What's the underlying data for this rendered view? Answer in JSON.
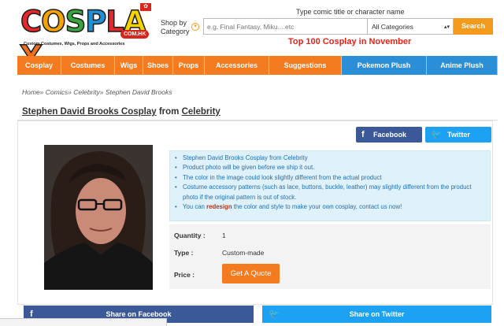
{
  "brand": {
    "logo_letters": [
      "C",
      "O",
      "S",
      "P",
      "L",
      "A",
      "Y"
    ],
    "logo_colors": [
      "#e5262b",
      "#f5a300",
      "#3aa53f",
      "#1f8fd6",
      "#e5262b",
      "#f5d100",
      "#ed6f1e"
    ],
    "logo_badge": "COM.HK",
    "logo_tagline": "Custom Costumes, Wigs, Props and Accessories"
  },
  "header": {
    "shop_by_line1": "Shop by",
    "shop_by_line2": "Category",
    "search_hint": "Type comic title or character name",
    "search_placeholder": "e.g. Final Fantasy, Miku....etc",
    "category_selected": "All Categories",
    "search_button": "Search",
    "promo_link": "Top 100 Cosplay in November"
  },
  "nav": {
    "items": [
      {
        "label": "Cosplay",
        "color": "#f47b20"
      },
      {
        "label": "Costumes",
        "color": "#f47b20"
      },
      {
        "label": "Wigs",
        "color": "#f47b20"
      },
      {
        "label": "Shoes",
        "color": "#f47b20"
      },
      {
        "label": "Props",
        "color": "#f47b20"
      },
      {
        "label": "Accessories",
        "color": "#f47b20"
      },
      {
        "label": "Suggestions",
        "color": "#f47b20"
      },
      {
        "label": "Pokemon Plush",
        "color": "#2a8fd6"
      },
      {
        "label": "Anime Plush",
        "color": "#2a8fd6"
      }
    ]
  },
  "breadcrumb": {
    "home": "Home»",
    "comics": "Comics»",
    "celebrity": "Celebrity»",
    "current": "Stephen David Brooks"
  },
  "product": {
    "title_main": "Stephen David Brooks Cosplay",
    "title_from": "from",
    "title_category": "Celebrity",
    "share_facebook": "Facebook",
    "share_twitter": "Twitter",
    "info": [
      "Stephen David Brooks Cosplay from Celebrity",
      "Product photo will be given before we ship it out.",
      "The color in the image could look slightly different from the actual product",
      "Costume accessory patterns (such as lace, buttons, buckle, leather) may slightly different from the product photo if the original pattern is out of stock."
    ],
    "info_redesign_prefix": "You can",
    "info_redesign_word": "redesign",
    "info_redesign_suffix": "the color and style to make your own cosplay, contact us now!",
    "quantity_label": "Quantity :",
    "quantity_value": "1",
    "type_label": "Type :",
    "type_value": "Custom-made",
    "price_label": "Price :",
    "quote_button": "Get A Quote"
  },
  "share_bar": {
    "facebook": "Share on Facebook",
    "twitter": "Share on Twitter"
  }
}
